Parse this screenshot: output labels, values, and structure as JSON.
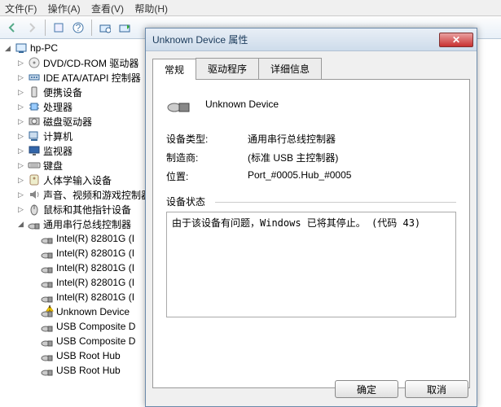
{
  "menu": {
    "items": [
      "文件(F)",
      "操作(A)",
      "查看(V)",
      "帮助(H)"
    ]
  },
  "tree": {
    "root": "hp-PC",
    "nodes": [
      {
        "label": "DVD/CD-ROM 驱动器",
        "icon": "disc"
      },
      {
        "label": "IDE ATA/ATAPI 控制器",
        "icon": "ide"
      },
      {
        "label": "便携设备",
        "icon": "portable"
      },
      {
        "label": "处理器",
        "icon": "cpu"
      },
      {
        "label": "磁盘驱动器",
        "icon": "disk"
      },
      {
        "label": "计算机",
        "icon": "computer"
      },
      {
        "label": "监视器",
        "icon": "monitor"
      },
      {
        "label": "键盘",
        "icon": "keyboard"
      },
      {
        "label": "人体学输入设备",
        "icon": "hid"
      },
      {
        "label": "声音、视频和游戏控制器",
        "icon": "sound"
      },
      {
        "label": "鼠标和其他指针设备",
        "icon": "mouse"
      },
      {
        "label": "通用串行总线控制器",
        "icon": "usb",
        "expanded": true,
        "children": [
          {
            "label": "Intel(R) 82801G (I",
            "icon": "usb"
          },
          {
            "label": "Intel(R) 82801G (I",
            "icon": "usb"
          },
          {
            "label": "Intel(R) 82801G (I",
            "icon": "usb"
          },
          {
            "label": "Intel(R) 82801G (I",
            "icon": "usb"
          },
          {
            "label": "Intel(R) 82801G (I",
            "icon": "usb"
          },
          {
            "label": "Unknown Device",
            "icon": "usb-warn"
          },
          {
            "label": "USB Composite D",
            "icon": "usb"
          },
          {
            "label": "USB Composite D",
            "icon": "usb"
          },
          {
            "label": "USB Root Hub",
            "icon": "usb"
          },
          {
            "label": "USB Root Hub",
            "icon": "usb"
          }
        ]
      }
    ]
  },
  "dialog": {
    "title": "Unknown Device 属性",
    "tabs": [
      "常规",
      "驱动程序",
      "详细信息"
    ],
    "active_tab": 0,
    "device_name": "Unknown Device",
    "props": {
      "type_k": "设备类型:",
      "type_v": "通用串行总线控制器",
      "mfr_k": "制造商:",
      "mfr_v": "(标准 USB 主控制器)",
      "loc_k": "位置:",
      "loc_v": "Port_#0005.Hub_#0005"
    },
    "status_label": "设备状态",
    "status_text": "由于该设备有问题，Windows 已将其停止。 (代码 43)",
    "ok": "确定",
    "cancel": "取消"
  }
}
